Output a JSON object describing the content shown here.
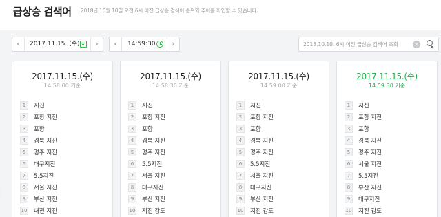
{
  "header": {
    "title": "급상승 검색어",
    "subtitle": "2018년 10월 10일 오전 6시 이전 급상승 검색어 순위와 추이를 확인할 수 있습니다."
  },
  "controls": {
    "date": {
      "value": "2017.11.15. (수)",
      "prev": "‹",
      "next": "›"
    },
    "time": {
      "value": "14:59:30",
      "prev": "‹",
      "next": "›"
    },
    "search": {
      "placeholder": "2018.10.10. 6시 이전 급상승 검색어 조회",
      "clear": "×"
    }
  },
  "icons": {
    "date": "calendar-icon",
    "time": "clock-icon",
    "search": "search-icon",
    "clear": "clear-icon"
  },
  "colors": {
    "accent": "#22b14c"
  },
  "cards": [
    {
      "date": "2017.11.15.(수)",
      "time": "14:58:00 기준",
      "items": [
        {
          "rank": "1",
          "keyword": "지진"
        },
        {
          "rank": "2",
          "keyword": "포항 지진"
        },
        {
          "rank": "3",
          "keyword": "포항"
        },
        {
          "rank": "4",
          "keyword": "경북 지진"
        },
        {
          "rank": "5",
          "keyword": "경주 지진"
        },
        {
          "rank": "6",
          "keyword": "대구지진"
        },
        {
          "rank": "7",
          "keyword": "5.5지진"
        },
        {
          "rank": "8",
          "keyword": "서울 지진"
        },
        {
          "rank": "9",
          "keyword": "부산 지진"
        },
        {
          "rank": "10",
          "keyword": "대전 지진"
        }
      ]
    },
    {
      "date": "2017.11.15.(수)",
      "time": "14:58:30 기준",
      "items": [
        {
          "rank": "1",
          "keyword": "지진"
        },
        {
          "rank": "2",
          "keyword": "포항 지진"
        },
        {
          "rank": "3",
          "keyword": "포항"
        },
        {
          "rank": "4",
          "keyword": "경북 지진"
        },
        {
          "rank": "5",
          "keyword": "경주 지진"
        },
        {
          "rank": "6",
          "keyword": "5.5지진"
        },
        {
          "rank": "7",
          "keyword": "서울 지진"
        },
        {
          "rank": "8",
          "keyword": "대구지진"
        },
        {
          "rank": "9",
          "keyword": "부산 지진"
        },
        {
          "rank": "10",
          "keyword": "지진 강도"
        }
      ]
    },
    {
      "date": "2017.11.15.(수)",
      "time": "14:59:00 기준",
      "items": [
        {
          "rank": "1",
          "keyword": "지진"
        },
        {
          "rank": "2",
          "keyword": "포항 지진"
        },
        {
          "rank": "3",
          "keyword": "포항"
        },
        {
          "rank": "4",
          "keyword": "경북 지진"
        },
        {
          "rank": "5",
          "keyword": "경주 지진"
        },
        {
          "rank": "6",
          "keyword": "5.5지진"
        },
        {
          "rank": "7",
          "keyword": "서울 지진"
        },
        {
          "rank": "8",
          "keyword": "대구지진"
        },
        {
          "rank": "9",
          "keyword": "부산 지진"
        },
        {
          "rank": "10",
          "keyword": "지진 강도"
        }
      ]
    },
    {
      "date": "2017.11.15.(수)",
      "time": "14:59:30 기준",
      "active": true,
      "items": [
        {
          "rank": "1",
          "keyword": "지진"
        },
        {
          "rank": "2",
          "keyword": "포항 지진"
        },
        {
          "rank": "3",
          "keyword": "포항"
        },
        {
          "rank": "4",
          "keyword": "경북 지진"
        },
        {
          "rank": "5",
          "keyword": "경주 지진"
        },
        {
          "rank": "6",
          "keyword": "서울 지진"
        },
        {
          "rank": "7",
          "keyword": "5.5지진"
        },
        {
          "rank": "8",
          "keyword": "부산 지진"
        },
        {
          "rank": "9",
          "keyword": "대구지진"
        },
        {
          "rank": "10",
          "keyword": "지진 강도"
        }
      ]
    }
  ]
}
